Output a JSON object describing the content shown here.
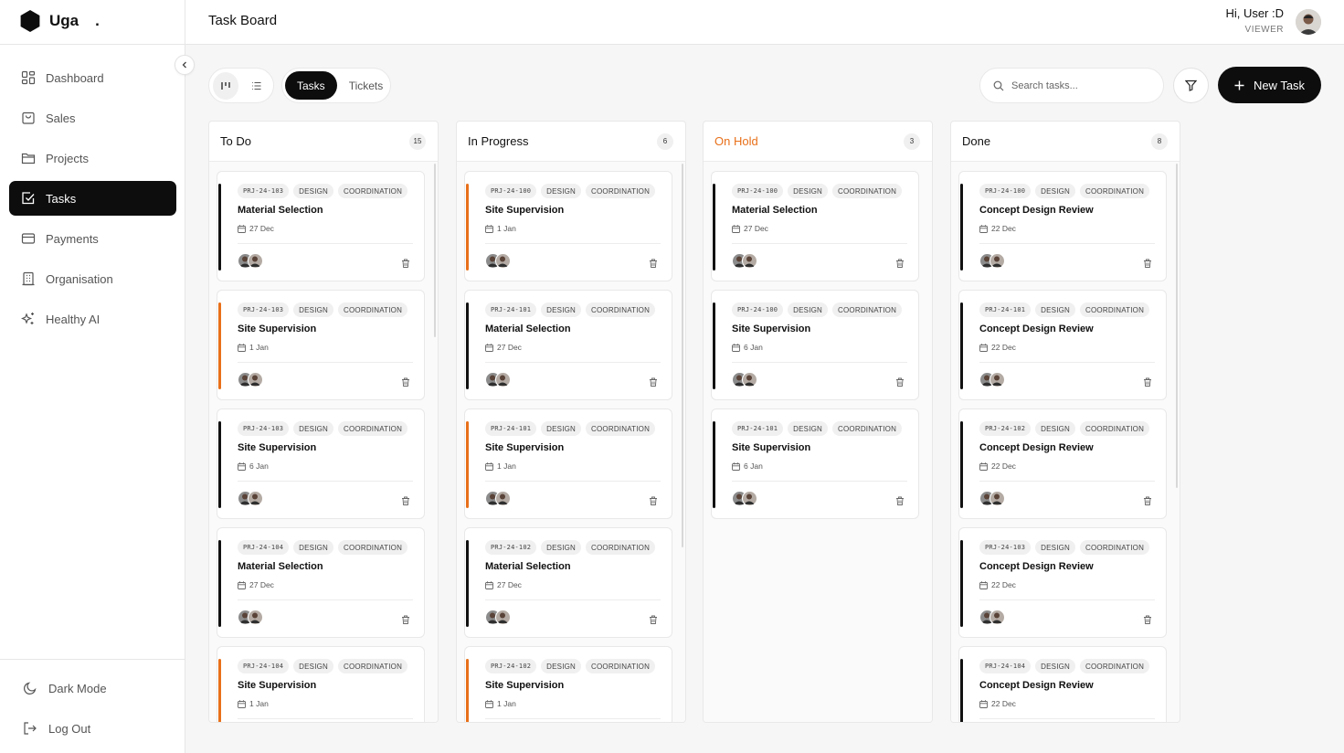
{
  "brand": {
    "name": "Uga",
    "dot": "."
  },
  "header": {
    "title": "Task Board",
    "greeting": "Hi, User :D",
    "role": "VIEWER"
  },
  "sidebar": {
    "items": [
      {
        "label": "Dashboard",
        "icon": "dashboard-icon",
        "active": false
      },
      {
        "label": "Sales",
        "icon": "shopping-bag-icon",
        "active": false
      },
      {
        "label": "Projects",
        "icon": "folder-icon",
        "active": false
      },
      {
        "label": "Tasks",
        "icon": "checkbox-icon",
        "active": true
      },
      {
        "label": "Payments",
        "icon": "credit-card-icon",
        "active": false
      },
      {
        "label": "Organisation",
        "icon": "building-icon",
        "active": false
      },
      {
        "label": "Healthy AI",
        "icon": "sparkles-icon",
        "active": false
      }
    ],
    "dark_mode": "Dark Mode",
    "logout": "Log Out"
  },
  "toolbar": {
    "tabs": [
      "Tasks",
      "Tickets"
    ],
    "active_tab": "Tasks",
    "search_placeholder": "Search tasks...",
    "new_task": "New Task"
  },
  "colors": {
    "accent": "#0d0d0d",
    "orange": "#e8701a",
    "black_bar": "#111111"
  },
  "columns": [
    {
      "title": "To Do",
      "count": "15",
      "cards": [
        {
          "code": "PRJ-24-103",
          "tags": [
            "DESIGN",
            "COORDINATION"
          ],
          "title": "Material Selection",
          "date": "27 Dec",
          "bar": "black"
        },
        {
          "code": "PRJ-24-103",
          "tags": [
            "DESIGN",
            "COORDINATION"
          ],
          "title": "Site Supervision",
          "date": "1 Jan",
          "bar": "orange"
        },
        {
          "code": "PRJ-24-103",
          "tags": [
            "DESIGN",
            "COORDINATION"
          ],
          "title": "Site Supervision",
          "date": "6 Jan",
          "bar": "black"
        },
        {
          "code": "PRJ-24-104",
          "tags": [
            "DESIGN",
            "COORDINATION"
          ],
          "title": "Material Selection",
          "date": "27 Dec",
          "bar": "black"
        },
        {
          "code": "PRJ-24-104",
          "tags": [
            "DESIGN",
            "COORDINATION"
          ],
          "title": "Site Supervision",
          "date": "1 Jan",
          "bar": "orange"
        }
      ]
    },
    {
      "title": "In Progress",
      "count": "6",
      "cards": [
        {
          "code": "PRJ-24-100",
          "tags": [
            "DESIGN",
            "COORDINATION"
          ],
          "title": "Site Supervision",
          "date": "1 Jan",
          "bar": "orange"
        },
        {
          "code": "PRJ-24-101",
          "tags": [
            "DESIGN",
            "COORDINATION"
          ],
          "title": "Material Selection",
          "date": "27 Dec",
          "bar": "black"
        },
        {
          "code": "PRJ-24-101",
          "tags": [
            "DESIGN",
            "COORDINATION"
          ],
          "title": "Site Supervision",
          "date": "1 Jan",
          "bar": "orange"
        },
        {
          "code": "PRJ-24-102",
          "tags": [
            "DESIGN",
            "COORDINATION"
          ],
          "title": "Material Selection",
          "date": "27 Dec",
          "bar": "black"
        },
        {
          "code": "PRJ-24-102",
          "tags": [
            "DESIGN",
            "COORDINATION"
          ],
          "title": "Site Supervision",
          "date": "1 Jan",
          "bar": "orange"
        }
      ]
    },
    {
      "title": "On Hold",
      "count": "3",
      "cards": [
        {
          "code": "PRJ-24-100",
          "tags": [
            "DESIGN",
            "COORDINATION"
          ],
          "title": "Material Selection",
          "date": "27 Dec",
          "bar": "black"
        },
        {
          "code": "PRJ-24-100",
          "tags": [
            "DESIGN",
            "COORDINATION"
          ],
          "title": "Site Supervision",
          "date": "6 Jan",
          "bar": "black"
        },
        {
          "code": "PRJ-24-101",
          "tags": [
            "DESIGN",
            "COORDINATION"
          ],
          "title": "Site Supervision",
          "date": "6 Jan",
          "bar": "black"
        }
      ]
    },
    {
      "title": "Done",
      "count": "8",
      "cards": [
        {
          "code": "PRJ-24-100",
          "tags": [
            "DESIGN",
            "COORDINATION"
          ],
          "title": "Concept Design Review",
          "date": "22 Dec",
          "bar": "black"
        },
        {
          "code": "PRJ-24-101",
          "tags": [
            "DESIGN",
            "COORDINATION"
          ],
          "title": "Concept Design Review",
          "date": "22 Dec",
          "bar": "black"
        },
        {
          "code": "PRJ-24-102",
          "tags": [
            "DESIGN",
            "COORDINATION"
          ],
          "title": "Concept Design Review",
          "date": "22 Dec",
          "bar": "black"
        },
        {
          "code": "PRJ-24-103",
          "tags": [
            "DESIGN",
            "COORDINATION"
          ],
          "title": "Concept Design Review",
          "date": "22 Dec",
          "bar": "black"
        },
        {
          "code": "PRJ-24-104",
          "tags": [
            "DESIGN",
            "COORDINATION"
          ],
          "title": "Concept Design Review",
          "date": "22 Dec",
          "bar": "black"
        }
      ]
    }
  ]
}
